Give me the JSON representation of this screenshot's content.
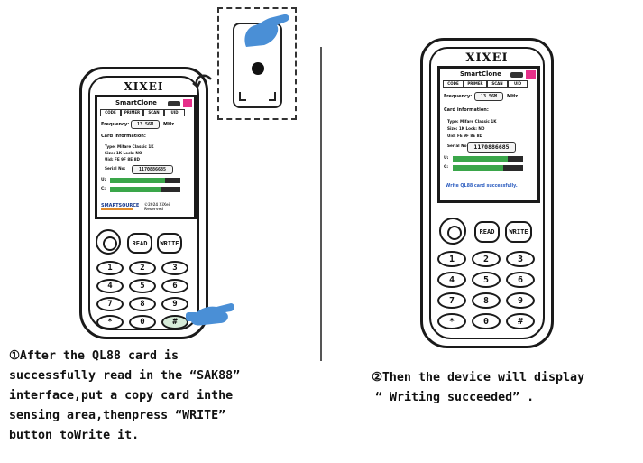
{
  "left": {
    "brand": "XIXEI",
    "screen": {
      "title": "SmartClone",
      "tabs": [
        "CODE",
        "PRIMER",
        "SCAN",
        "UID"
      ],
      "freq_label": "Frequency:",
      "freq_value": "13.56M",
      "freq_unit": "MHz",
      "card_info_label": "Card information:",
      "info_lines": [
        "Type:   Mifare Classic 1K",
        "Size:   1K        Lock: NO",
        "Uid:    FE 9F 8E 8D"
      ],
      "id_label": "Serial No:",
      "id_value": "1170886685",
      "bars": [
        {
          "label": "U:",
          "fill": 0.78
        },
        {
          "label": "C:",
          "fill": 0.72
        }
      ],
      "logo": "SMARTSOURCE",
      "copyright": "©2024 XiXei Reserved"
    },
    "buttons": {
      "read": "READ",
      "write": "WRITE"
    },
    "keys": [
      "1",
      "2",
      "3",
      "4",
      "5",
      "6",
      "7",
      "8",
      "9",
      "*",
      "0",
      "#"
    ],
    "caption": [
      "①After the QL88  card is",
      "successfully read in the “SAK88”",
      "interface,put a copy card inthe",
      "sensing area,thenpress “WRITE”",
      "button toWrite it."
    ]
  },
  "right": {
    "brand": "XIXEI",
    "screen": {
      "title": "SmartClone",
      "tabs": [
        "CODE",
        "PRIMER",
        "SCAN",
        "UID"
      ],
      "freq_label": "Frequency:",
      "freq_value": "13.56M",
      "freq_unit": "MHz",
      "card_info_label": "Card information:",
      "info_lines": [
        "Type:   Mifare Classic 1K",
        "Size:   1K        Lock: NO",
        "Uid:    FE 9F 8E 8D"
      ],
      "id_label": "Serial No:",
      "id_value": "1170886685",
      "bars": [
        {
          "label": "U:",
          "fill": 0.78
        },
        {
          "label": "C:",
          "fill": 0.72
        }
      ],
      "status": "Write QL88 card successfully."
    },
    "buttons": {
      "read": "READ",
      "write": "WRITE"
    },
    "keys": [
      "1",
      "2",
      "3",
      "4",
      "5",
      "6",
      "7",
      "8",
      "9",
      "*",
      "0",
      "#"
    ],
    "caption": [
      "②Then the device will display",
      "“ Writing succeeded” ."
    ]
  },
  "colors": {
    "accent_green": "#3aa64a",
    "accent_blue": "#2f5fc0",
    "pink": "#e6308a",
    "hand_blue": "#4a8fd6"
  }
}
